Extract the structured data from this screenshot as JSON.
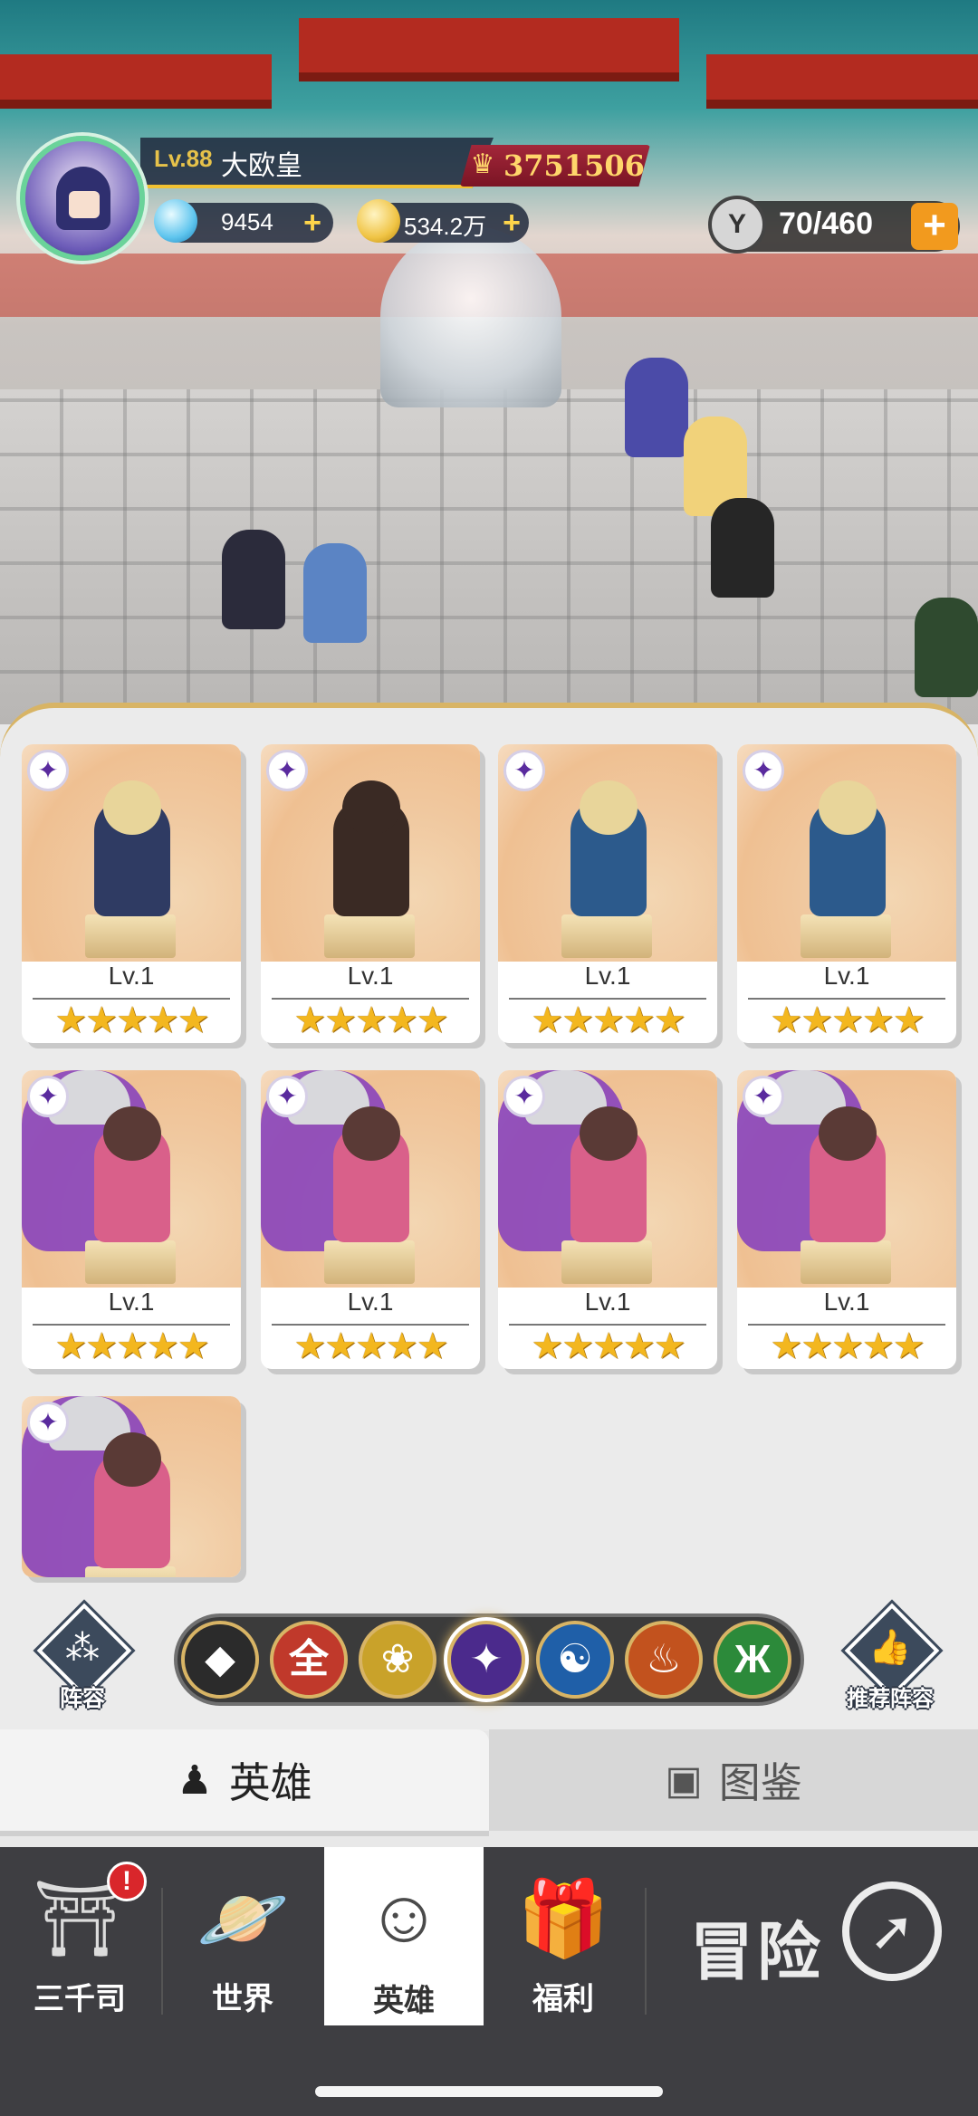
{
  "player": {
    "level_label": "Lv.88",
    "name": "大欧皇",
    "power": "3751506",
    "diamonds": "9454",
    "gold": "534.2万",
    "stamina": "70/460"
  },
  "hero_cards": [
    {
      "level": "Lv.1",
      "stars": "★★★★★",
      "element": "fire",
      "color": "#2f3b63"
    },
    {
      "level": "Lv.1",
      "stars": "★★★★★",
      "element": "fire",
      "color": "#3a2a24"
    },
    {
      "level": "Lv.1",
      "stars": "★★★★★",
      "element": "fire",
      "color": "#2c5a8c"
    },
    {
      "level": "Lv.1",
      "stars": "★★★★★",
      "element": "fire",
      "color": "#2c5a8c"
    },
    {
      "level": "Lv.1",
      "stars": "★★★★★",
      "element": "fire",
      "color": "#d9608a"
    },
    {
      "level": "Lv.1",
      "stars": "★★★★★",
      "element": "fire",
      "color": "#d9608a"
    },
    {
      "level": "Lv.1",
      "stars": "★★★★★",
      "element": "fire",
      "color": "#d9608a"
    },
    {
      "level": "Lv.1",
      "stars": "★★★★★",
      "element": "fire",
      "color": "#d9608a"
    },
    {
      "level": "",
      "stars": "",
      "element": "fire",
      "color": "#d9608a"
    }
  ],
  "toolbar": {
    "lineup_label": "阵容",
    "recommended_label": "推荐阵容",
    "filters": [
      {
        "icon": "diamond-cluster",
        "glyph": "◆",
        "bg": "#2b2b2b"
      },
      {
        "icon": "all",
        "glyph": "全",
        "bg": "#c0392b"
      },
      {
        "icon": "lotus",
        "glyph": "❀",
        "bg": "#c9a22a"
      },
      {
        "icon": "fire",
        "glyph": "✦",
        "bg": "#4b2a8c"
      },
      {
        "icon": "water-swirl",
        "glyph": "☯",
        "bg": "#1f5fa8"
      },
      {
        "icon": "meditation",
        "glyph": "♨",
        "bg": "#c2521e"
      },
      {
        "icon": "dna",
        "glyph": "Ж",
        "bg": "#2c8a3a"
      }
    ]
  },
  "tabs": {
    "heroes": "英雄",
    "codex": "图鉴"
  },
  "nav": {
    "items": [
      {
        "label": "三千司",
        "icon": "temple-icon"
      },
      {
        "label": "世界",
        "icon": "planet-icon"
      },
      {
        "label": "英雄",
        "icon": "hero-icon"
      },
      {
        "label": "福利",
        "icon": "gift-icon"
      }
    ],
    "adventure": "冒险",
    "badge": "!"
  },
  "colors": {
    "accent_gold": "#d8b465",
    "star": "#f3b71f",
    "nav_bg": "#3e3e42"
  }
}
